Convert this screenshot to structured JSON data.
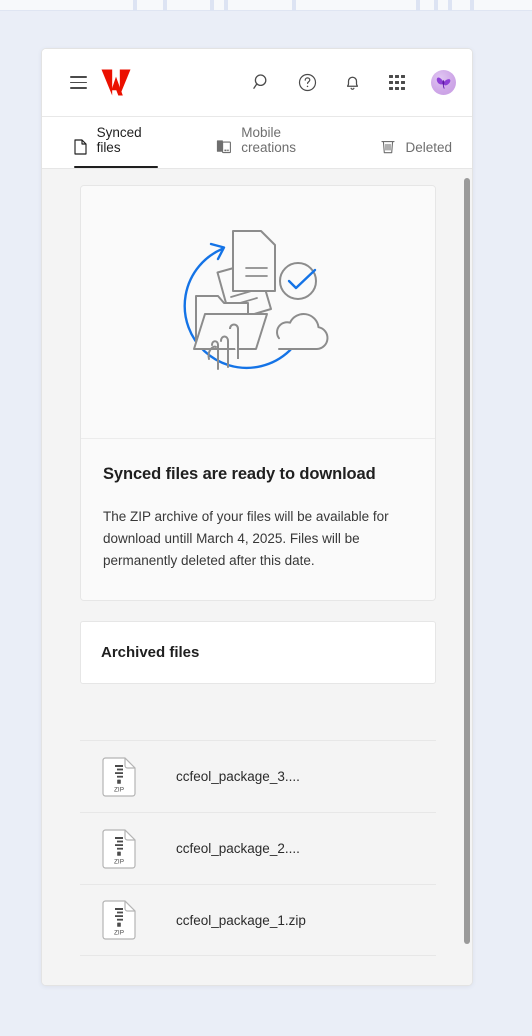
{
  "window": {
    "background_color": "#eaeef7",
    "card_background": "#ffffff"
  },
  "header": {
    "menu_label": "Main menu",
    "brand_label": "Adobe",
    "brand_color": "#EB1000",
    "actions": [
      {
        "name": "search-icon",
        "label": "Search"
      },
      {
        "name": "help-icon",
        "label": "Help"
      },
      {
        "name": "notifications-icon",
        "label": "Notifications"
      },
      {
        "name": "app-switcher-icon",
        "label": "Apps"
      }
    ],
    "avatar_label": "Account",
    "avatar_color": "#c79ce3"
  },
  "tabs": [
    {
      "label": "Synced files",
      "icon": "document-icon",
      "active": true
    },
    {
      "label": "Mobile creations",
      "icon": "mobile-device-icon",
      "active": false
    },
    {
      "label": "Deleted",
      "icon": "trash-icon",
      "active": false
    }
  ],
  "hero": {
    "illustration_name": "sync-files-cloud-illustration",
    "accent_color": "#1473E6",
    "line_color": "#8C8C8C",
    "title": "Synced files are ready to download",
    "body": "The ZIP archive of your files will be available for download untill March 4, 2025. Files will be permanently deleted after this date."
  },
  "archived": {
    "title": "Archived files"
  },
  "files": [
    {
      "name": "ccfeol_package_3....",
      "type": "ZIP"
    },
    {
      "name": "ccfeol_package_2....",
      "type": "ZIP"
    },
    {
      "name": "ccfeol_package_1.zip",
      "type": "ZIP"
    }
  ],
  "file_icon_label": "ZIP",
  "scrollbar": {
    "name": "vertical-scrollbar",
    "thumb_color": "#9a9a9a"
  }
}
